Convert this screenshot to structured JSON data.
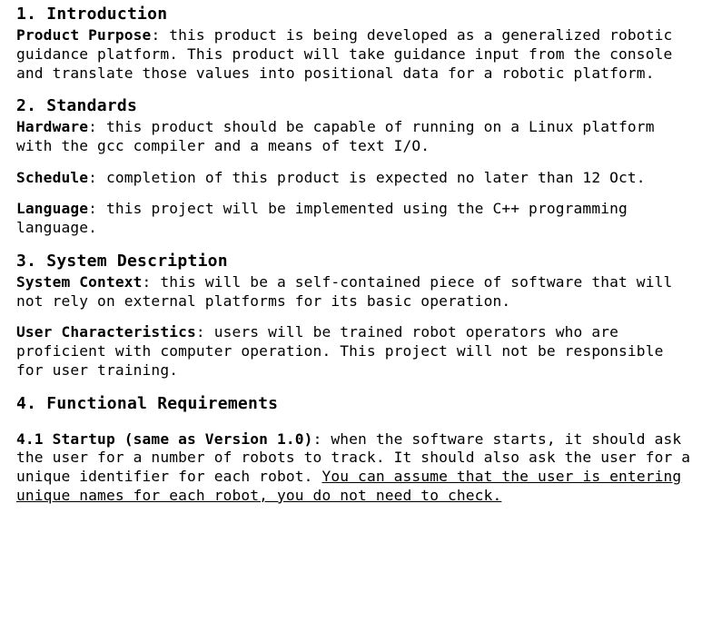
{
  "sections": {
    "s1": {
      "heading": "1. Introduction",
      "product_purpose_label": "Product Purpose",
      "product_purpose_text": ": this product is being developed as a generalized robotic guidance platform. This product will take guidance input from the console and translate those values into positional data for a robotic platform."
    },
    "s2": {
      "heading": "2. Standards",
      "hardware_label": "Hardware",
      "hardware_text": ": this product should be capable of running on a Linux platform with the gcc compiler and a means of text I/O.",
      "schedule_label": "Schedule",
      "schedule_text": ": completion of this product is expected no later than 12 Oct.",
      "language_label": "Language",
      "language_text": ": this project will be implemented using the C++ programming language."
    },
    "s3": {
      "heading": "3. System Description",
      "context_label": "System Context",
      "context_text": ": this will be a self-contained piece of software that will not rely on external platforms for its basic operation.",
      "users_label": "User Characteristics",
      "users_text": ": users will be trained robot operators who are proficient with computer operation. This project will not be responsible for user training."
    },
    "s4": {
      "heading": "4. Functional Requirements",
      "startup_label": "4.1 Startup (same as Version 1.0)",
      "startup_text": ": when the software starts, it should ask the user for a number of robots to track. It should also ask the user for a unique identifier for each robot. ",
      "startup_underlined": "You can assume that the user is entering unique names for each robot, you do not need to check."
    }
  }
}
